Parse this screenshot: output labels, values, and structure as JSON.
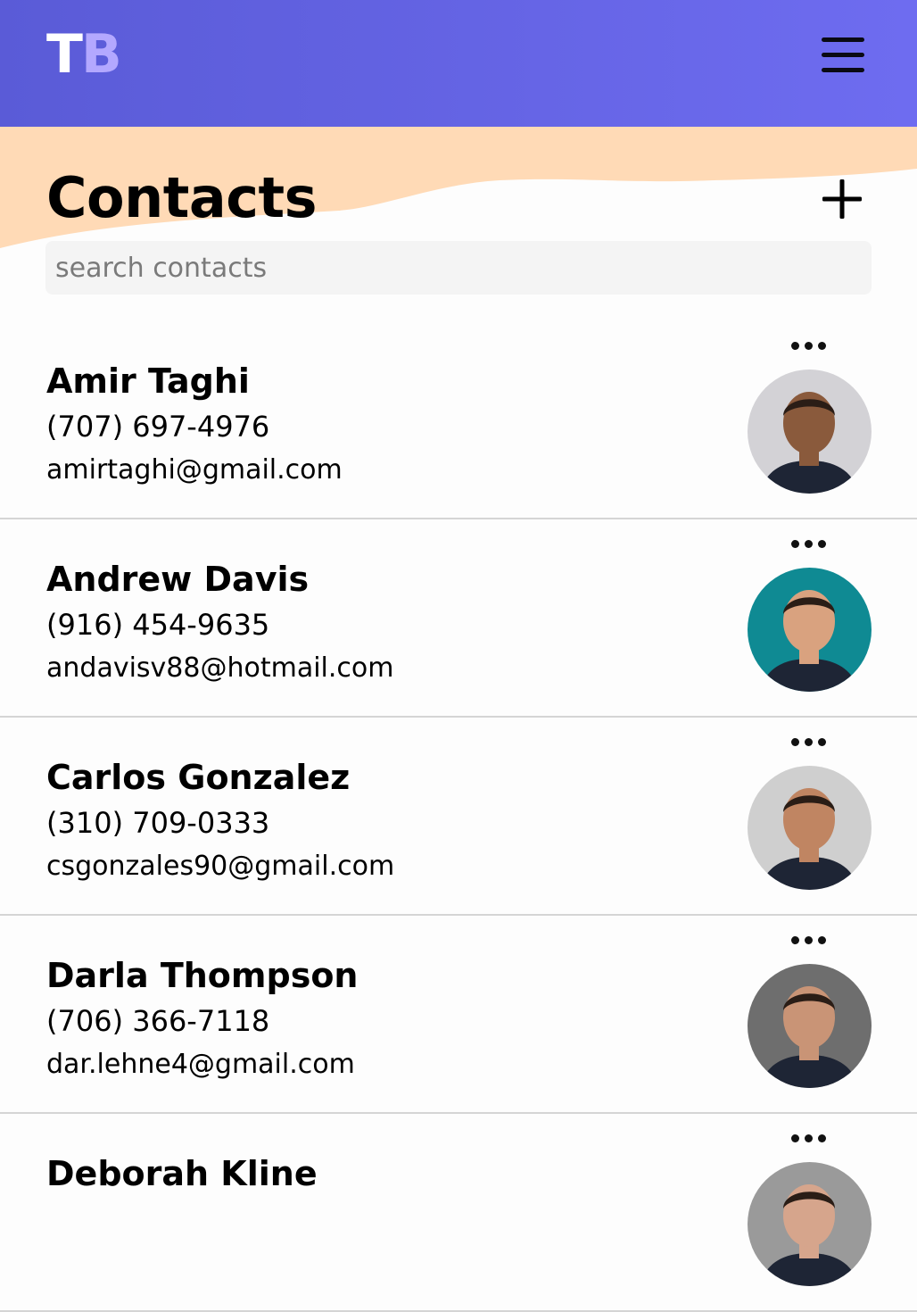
{
  "header": {
    "logo_first": "T",
    "logo_second": "B",
    "menu_icon": "hamburger-menu-icon"
  },
  "page": {
    "title": "Contacts",
    "add_icon": "plus-icon"
  },
  "search": {
    "placeholder": "search contacts",
    "value": ""
  },
  "contacts": [
    {
      "name": "Amir Taghi",
      "phone": "(707) 697-4976",
      "email": "amirtaghi@gmail.com",
      "avatar_bg": "#d3d2d6",
      "skin": "#8a5a3c"
    },
    {
      "name": "Andrew Davis",
      "phone": "(916) 454-9635",
      "email": "andavisv88@hotmail.com",
      "avatar_bg": "#0f8a93",
      "skin": "#d9a27f"
    },
    {
      "name": "Carlos Gonzalez",
      "phone": "(310) 709-0333",
      "email": "csgonzales90@gmail.com",
      "avatar_bg": "#cfcfcf",
      "skin": "#c08562"
    },
    {
      "name": "Darla Thompson",
      "phone": "(706) 366-7118",
      "email": "dar.lehne4@gmail.com",
      "avatar_bg": "#6e6e6e",
      "skin": "#c99476"
    },
    {
      "name": "Deborah Kline",
      "phone": "",
      "email": "",
      "avatar_bg": "#9a9a9a",
      "skin": "#d6a58c"
    }
  ],
  "colors": {
    "header_start": "#5a5bd7",
    "header_end": "#6e6cf0",
    "wave": "#ffdab6",
    "logo_accent": "#b3a8ff"
  }
}
